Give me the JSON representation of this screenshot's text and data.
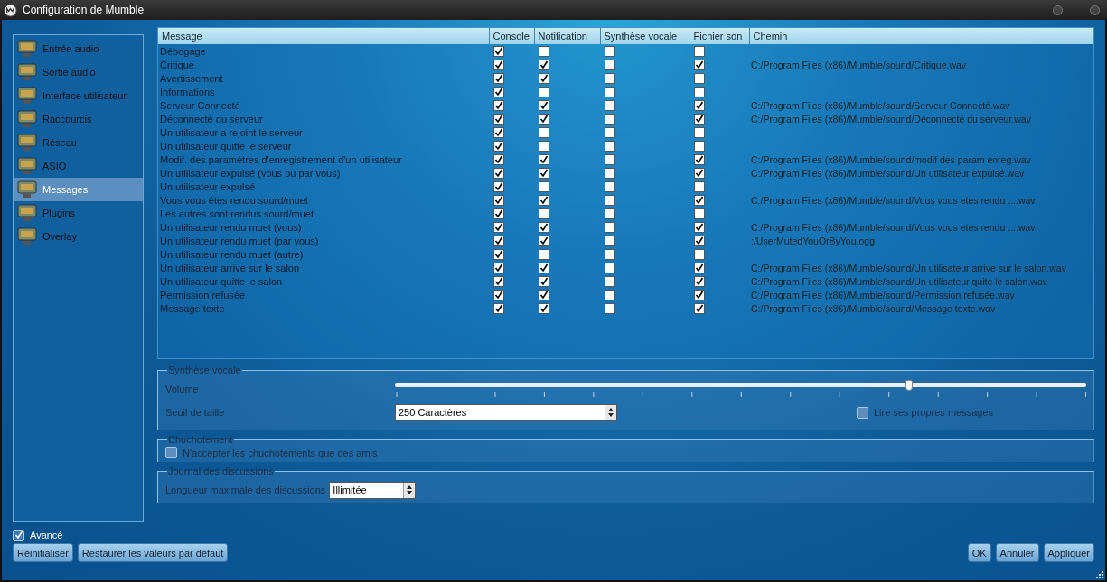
{
  "window": {
    "title": "Configuration de Mumble"
  },
  "sidebar": {
    "items": [
      {
        "label": "Entrée audio",
        "selected": false
      },
      {
        "label": "Sortie audio",
        "selected": false
      },
      {
        "label": "Interface utilisateur",
        "selected": false
      },
      {
        "label": "Raccourcis",
        "selected": false
      },
      {
        "label": "Réseau",
        "selected": false
      },
      {
        "label": "ASIO",
        "selected": false
      },
      {
        "label": "Messages",
        "selected": true
      },
      {
        "label": "Plugins",
        "selected": false
      },
      {
        "label": "Overlay",
        "selected": false
      }
    ]
  },
  "table": {
    "columns": [
      "Message",
      "Console",
      "Notification",
      "Synthèse vocale",
      "Fichier son",
      "Chemin"
    ],
    "rows": [
      {
        "message": "Débogage",
        "console": true,
        "notification": false,
        "tts": false,
        "sound": false
      },
      {
        "message": "Critique",
        "console": true,
        "notification": true,
        "tts": false,
        "sound": true,
        "path": "C:/Program Files (x86)/Mumble/sound/Critique.wav"
      },
      {
        "message": "Avertissement",
        "console": true,
        "notification": true,
        "tts": false,
        "sound": false
      },
      {
        "message": "Informations",
        "console": true,
        "notification": false,
        "tts": false,
        "sound": false
      },
      {
        "message": "Serveur Connecté",
        "console": true,
        "notification": true,
        "tts": false,
        "sound": true,
        "path": "C:/Program Files (x86)/Mumble/sound/Serveur Connecté.wav"
      },
      {
        "message": "Déconnecté du serveur",
        "console": true,
        "notification": true,
        "tts": false,
        "sound": true,
        "path": "C:/Program Files (x86)/Mumble/sound/Déconnecté du serveur.wav"
      },
      {
        "message": "Un utilisateur a rejoint le serveur",
        "console": true,
        "notification": false,
        "tts": false,
        "sound": false
      },
      {
        "message": "Un utilisateur quitte le serveur",
        "console": true,
        "notification": false,
        "tts": false,
        "sound": false
      },
      {
        "message": "Modif. des paramètres d'enregistrement d'un utilisateur",
        "console": true,
        "notification": true,
        "tts": false,
        "sound": true,
        "path": "C:/Program Files (x86)/Mumble/sound/modif des param enreg.wav"
      },
      {
        "message": "Un utilisateur expulsé (vous ou par vous)",
        "console": true,
        "notification": true,
        "tts": false,
        "sound": true,
        "path": "C:/Program Files (x86)/Mumble/sound/Un utilisateur expulsé.wav"
      },
      {
        "message": "Un utilisateur expulsé",
        "console": true,
        "notification": false,
        "tts": false,
        "sound": false
      },
      {
        "message": "Vous vous êtes rendu sourd/muet",
        "console": true,
        "notification": true,
        "tts": false,
        "sound": true,
        "path": "C:/Program Files (x86)/Mumble/sound/Vous vous etes rendu ....wav"
      },
      {
        "message": "Les autres sont rendus sourd/muet",
        "console": true,
        "notification": false,
        "tts": false,
        "sound": false
      },
      {
        "message": "Un utilisateur rendu muet (vous)",
        "console": true,
        "notification": true,
        "tts": false,
        "sound": true,
        "path": "C:/Program Files (x86)/Mumble/sound/Vous vous etes rendu ....wav"
      },
      {
        "message": "Un utilisateur rendu muet (par vous)",
        "console": true,
        "notification": true,
        "tts": false,
        "sound": true,
        "path": ":/UserMutedYouOrByYou.ogg"
      },
      {
        "message": "Un utilisateur rendu muet (autre)",
        "console": true,
        "notification": false,
        "tts": false,
        "sound": false
      },
      {
        "message": "Un utilisateur arrive sur le salon",
        "console": true,
        "notification": true,
        "tts": false,
        "sound": true,
        "path": "C:/Program Files (x86)/Mumble/sound/Un utilisateur arrive sur le salon.wav"
      },
      {
        "message": "Un utilisateur quitte le salon",
        "console": true,
        "notification": true,
        "tts": false,
        "sound": true,
        "path": "C:/Program Files (x86)/Mumble/sound/Un utilisateur quite le salon.wav"
      },
      {
        "message": "Permission refusée",
        "console": true,
        "notification": true,
        "tts": false,
        "sound": true,
        "path": "C:/Program Files (x86)/Mumble/sound/Permission refusée.wav"
      },
      {
        "message": "Message texte",
        "console": true,
        "notification": true,
        "tts": false,
        "sound": true,
        "path": "C:/Program Files (x86)/Mumble/sound/Message texte.wav"
      }
    ]
  },
  "tts": {
    "title": "Synthèse vocale",
    "volume_label": "Volume",
    "volume": {
      "level": 0.744
    },
    "threshold_label": "Seuil de taille",
    "threshold": "250 Caractères",
    "read_own": {
      "label": "Lire ses propres messages",
      "checked": false
    }
  },
  "whisper": {
    "title": "Chuchotement",
    "friends_only": {
      "label": "N'accepter les chuchotements que des amis",
      "checked": false
    }
  },
  "log": {
    "title": "Journal des discussions",
    "max_length_label": "Longueur maximale des discussions",
    "max_length": "Illimitée"
  },
  "advanced": {
    "label": "Avancé",
    "checked": true
  },
  "buttons_left": [
    "Réinitialiser",
    "Restaurer les valeurs par défaut"
  ],
  "buttons_right": [
    "OK",
    "Annuler",
    "Appliquer"
  ]
}
